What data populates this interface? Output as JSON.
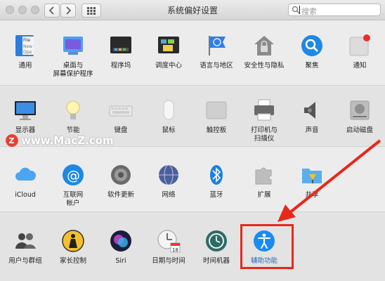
{
  "window": {
    "title": "系统偏好设置"
  },
  "search": {
    "placeholder": "搜索"
  },
  "watermark": {
    "text": "www.MacZ.com"
  },
  "rows": [
    [
      {
        "id": "general",
        "label": "通用"
      },
      {
        "id": "desktop",
        "label": "桌面与\n屏幕保护程序"
      },
      {
        "id": "dock",
        "label": "程序坞"
      },
      {
        "id": "mission",
        "label": "调度中心"
      },
      {
        "id": "language",
        "label": "语言与地区"
      },
      {
        "id": "security",
        "label": "安全性与隐私"
      },
      {
        "id": "spotlight",
        "label": "聚焦"
      },
      {
        "id": "notifications",
        "label": "通知"
      }
    ],
    [
      {
        "id": "displays",
        "label": "显示器"
      },
      {
        "id": "energy",
        "label": "节能"
      },
      {
        "id": "keyboard",
        "label": "键盘"
      },
      {
        "id": "mouse",
        "label": "鼠标"
      },
      {
        "id": "trackpad",
        "label": "触控板"
      },
      {
        "id": "printers",
        "label": "打印机与\n扫描仪"
      },
      {
        "id": "sound",
        "label": "声音"
      },
      {
        "id": "startup",
        "label": "启动磁盘"
      }
    ],
    [
      {
        "id": "icloud",
        "label": "iCloud"
      },
      {
        "id": "internet",
        "label": "互联网\n帐户"
      },
      {
        "id": "update",
        "label": "软件更新"
      },
      {
        "id": "network",
        "label": "网络"
      },
      {
        "id": "bluetooth",
        "label": "蓝牙"
      },
      {
        "id": "extensions",
        "label": "扩展"
      },
      {
        "id": "sharing",
        "label": "共享"
      }
    ],
    [
      {
        "id": "users",
        "label": "用户与群组"
      },
      {
        "id": "parental",
        "label": "家长控制"
      },
      {
        "id": "siri",
        "label": "Siri"
      },
      {
        "id": "datetime",
        "label": "日期与时间"
      },
      {
        "id": "timemachine",
        "label": "时间机器"
      },
      {
        "id": "accessibility",
        "label": "辅助功能"
      }
    ]
  ],
  "colors": {
    "highlight_box": "#e8281a",
    "arrow": "#e8281a"
  },
  "icons": {
    "general": "file-new-open-icon",
    "desktop": "desktop-screensaver-icon",
    "dock": "dock-icon",
    "mission": "mission-control-icon",
    "language": "flag-globe-icon",
    "security": "house-lock-icon",
    "spotlight": "magnifier-icon",
    "notifications": "notification-badge-icon",
    "displays": "monitor-icon",
    "energy": "lightbulb-icon",
    "keyboard": "keyboard-icon",
    "mouse": "mouse-icon",
    "trackpad": "trackpad-icon",
    "printers": "printer-icon",
    "sound": "speaker-icon",
    "startup": "hard-disk-icon",
    "icloud": "cloud-icon",
    "internet": "at-sign-icon",
    "update": "gear-update-icon",
    "network": "globe-network-icon",
    "bluetooth": "bluetooth-icon",
    "extensions": "puzzle-piece-icon",
    "sharing": "folder-sign-icon",
    "users": "users-silhouette-icon",
    "parental": "parental-figure-icon",
    "siri": "siri-orb-icon",
    "datetime": "calendar-clock-icon",
    "timemachine": "time-machine-icon",
    "accessibility": "accessibility-person-icon"
  }
}
